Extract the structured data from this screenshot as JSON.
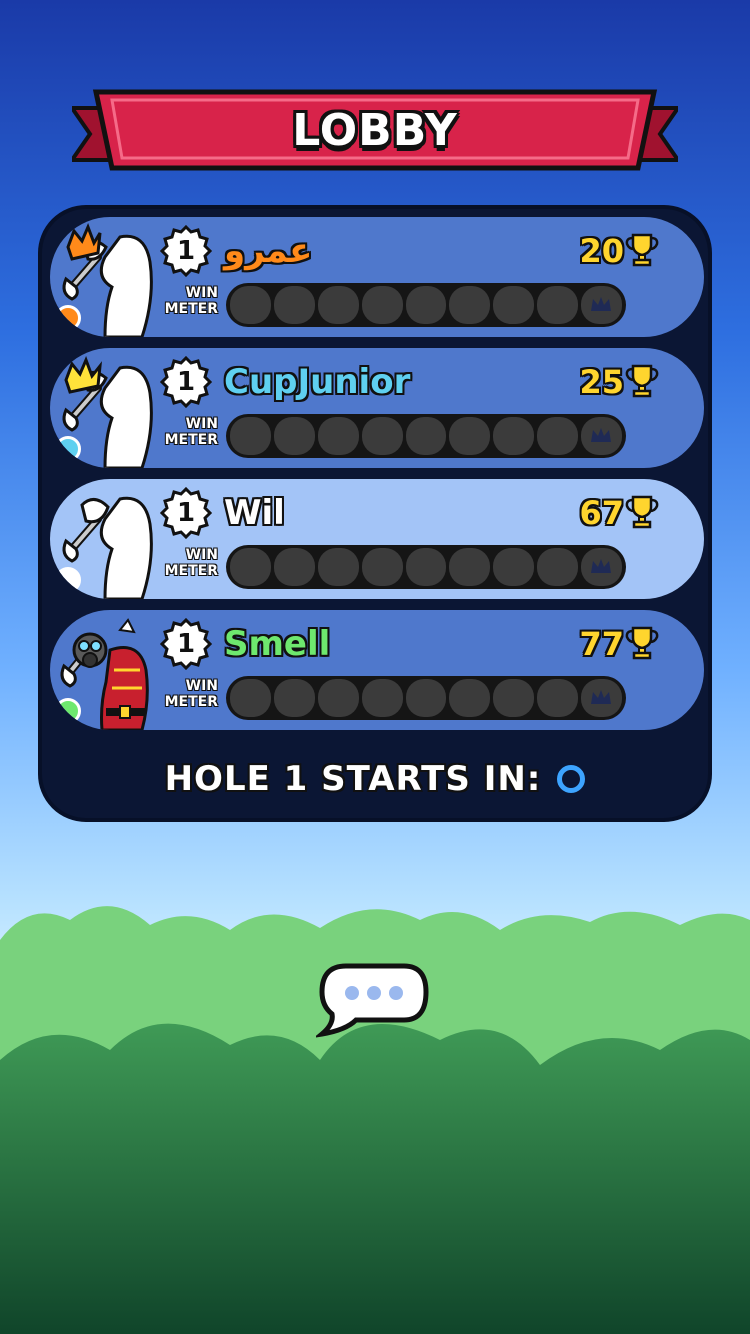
{
  "lobby": {
    "title": "LOBBY",
    "win_label_top": "WIN",
    "win_label_bottom": "METER",
    "players": [
      {
        "rank": "1",
        "name": "عمرو",
        "trophies": "20",
        "name_color": "#ff8a1a",
        "dot_color": "#ff8a1a",
        "highlight": false,
        "avatar": "golfer-crown-orange-icon"
      },
      {
        "rank": "1",
        "name": "CupJunior",
        "trophies": "25",
        "name_color": "#5fd0f0",
        "dot_color": "#5fd0f0",
        "highlight": false,
        "avatar": "golfer-crown-yellow-icon"
      },
      {
        "rank": "1",
        "name": "Wil",
        "trophies": "67",
        "name_color": "#ffffff",
        "dot_color": "#ffffff",
        "highlight": true,
        "avatar": "golfer-plain-icon"
      },
      {
        "rank": "1",
        "name": "Smell",
        "trophies": "77",
        "name_color": "#6ee86e",
        "dot_color": "#6ee86e",
        "highlight": false,
        "avatar": "golfer-gasmask-icon"
      }
    ],
    "win_meter_progress": 0,
    "win_meter_segments": 9,
    "starts_in_label": "HOLE 1 STARTS IN:",
    "countdown": "0"
  },
  "colors": {
    "banner_red": "#d8234a",
    "panel_bg": "#0b1634",
    "row_bg": "#4f78cc",
    "row_highlight": "#a3c4f7",
    "trophy_gold": "#ffd52e",
    "countdown_blue": "#3da4ff"
  },
  "chat": {
    "icon": "chat-bubble-icon"
  }
}
